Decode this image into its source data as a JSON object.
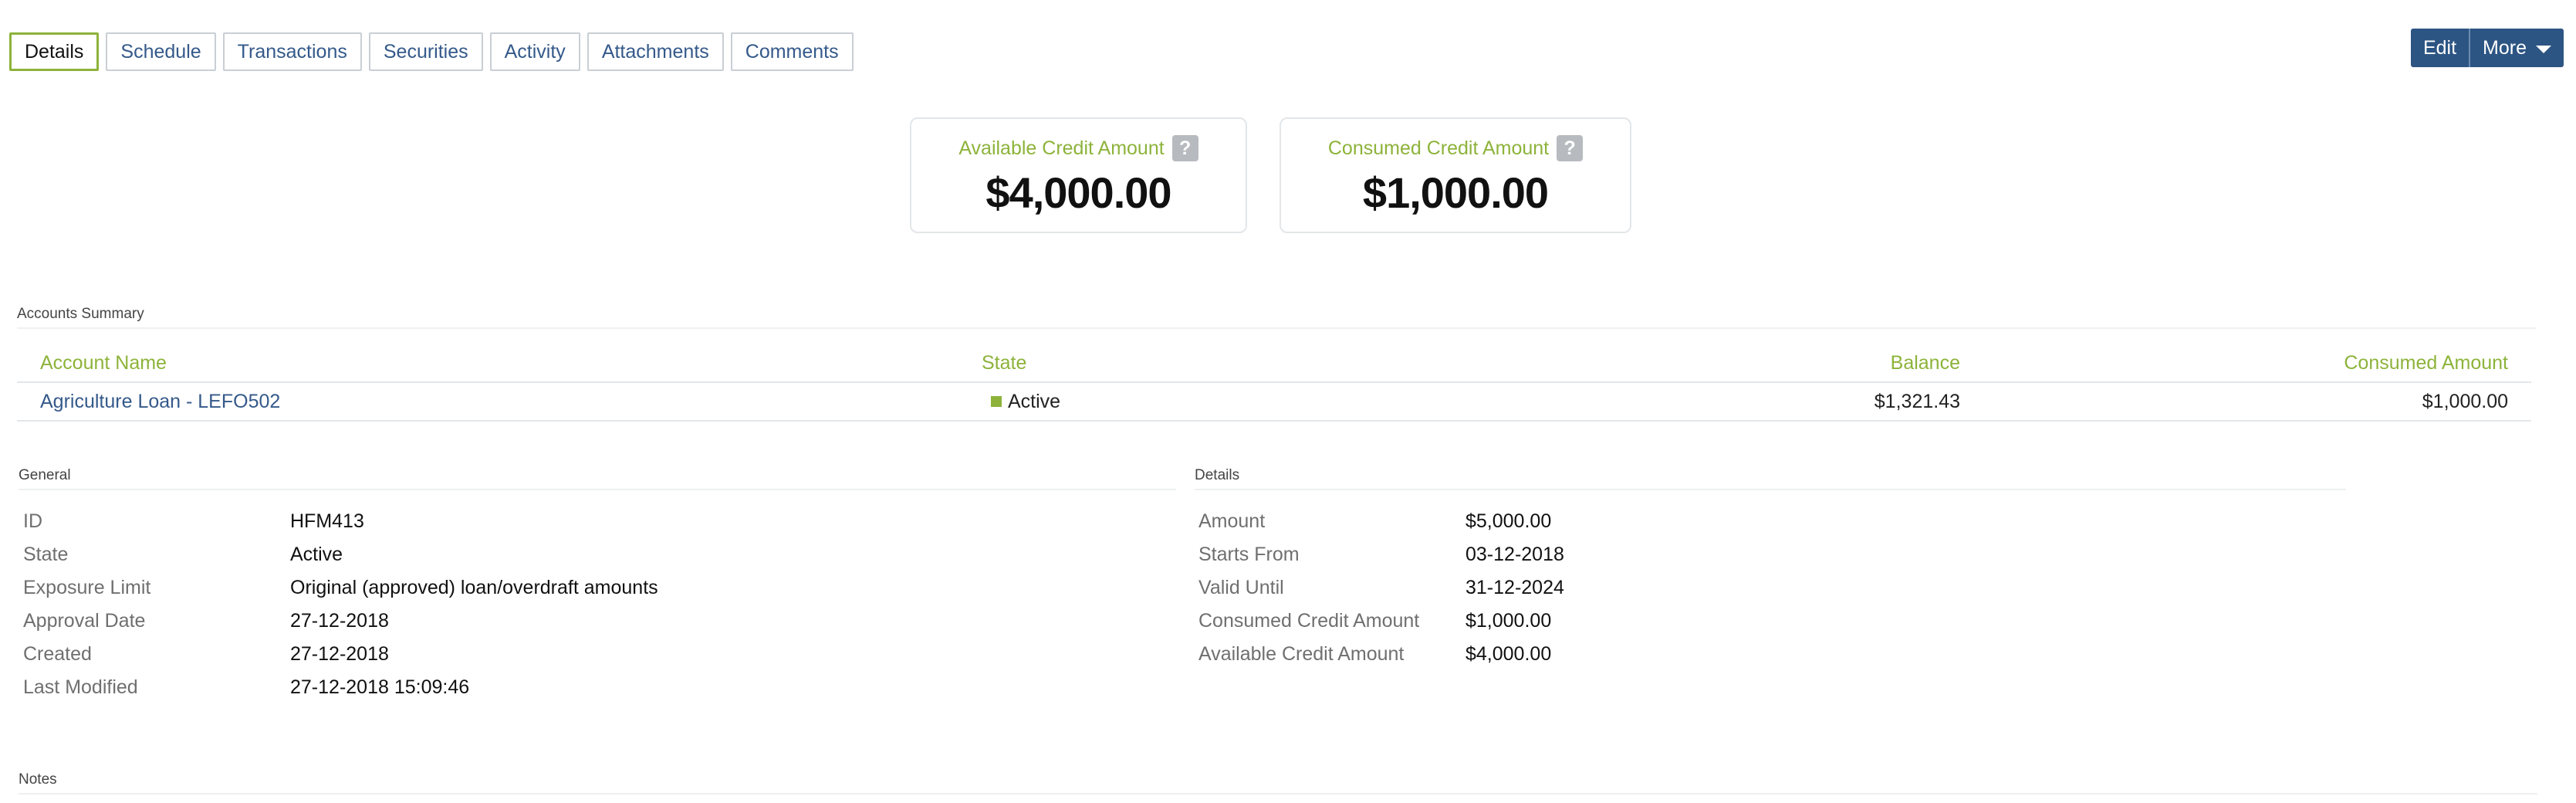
{
  "tabs": [
    "Details",
    "Schedule",
    "Transactions",
    "Securities",
    "Activity",
    "Attachments",
    "Comments"
  ],
  "toolbar": {
    "edit_label": "Edit",
    "more_label": "More"
  },
  "cards": [
    {
      "label": "Available Credit Amount",
      "value": "$4,000.00"
    },
    {
      "label": "Consumed Credit Amount",
      "value": "$1,000.00"
    }
  ],
  "help_glyph": "?",
  "accounts_summary": {
    "title": "Accounts Summary",
    "columns": [
      "Account Name",
      "State",
      "Balance",
      "Consumed Amount"
    ],
    "rows": [
      {
        "account_name": "Agriculture Loan - LEFO502",
        "state": "Active",
        "balance": "$1,321.43",
        "consumed": "$1,000.00"
      }
    ]
  },
  "general": {
    "title": "General",
    "rows": [
      {
        "key": "ID",
        "value": "HFM413"
      },
      {
        "key": "State",
        "value": "Active"
      },
      {
        "key": "Exposure Limit",
        "value": "Original (approved) loan/overdraft amounts"
      },
      {
        "key": "Approval Date",
        "value": "27-12-2018"
      },
      {
        "key": "Created",
        "value": "27-12-2018"
      },
      {
        "key": "Last Modified",
        "value": "27-12-2018 15:09:46"
      }
    ]
  },
  "details": {
    "title": "Details",
    "rows": [
      {
        "key": "Amount",
        "value": "$5,000.00"
      },
      {
        "key": "Starts From",
        "value": "03-12-2018"
      },
      {
        "key": "Valid Until",
        "value": "31-12-2024"
      },
      {
        "key": "Consumed Credit Amount",
        "value": "$1,000.00"
      },
      {
        "key": "Available Credit Amount",
        "value": "$4,000.00"
      }
    ]
  },
  "notes": {
    "title": "Notes"
  },
  "colors": {
    "accent_green": "#8db33a",
    "link_blue": "#34598a",
    "button_blue": "#2c5583"
  }
}
